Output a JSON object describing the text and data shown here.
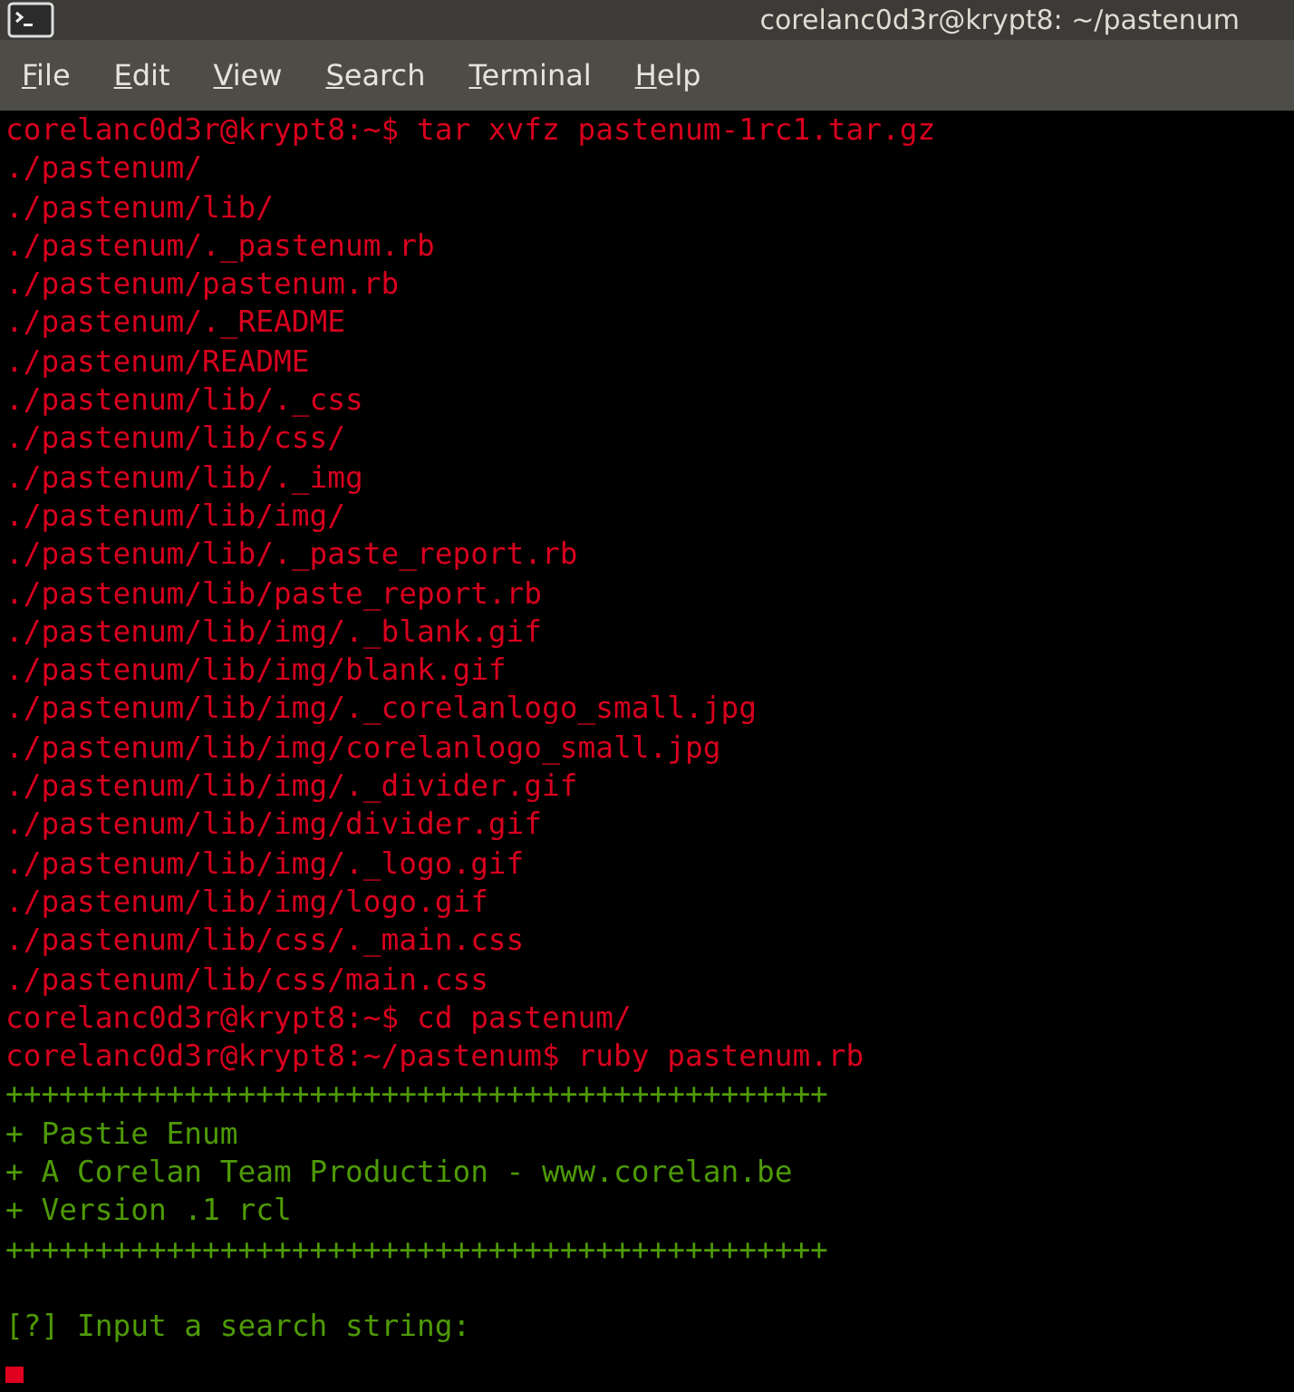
{
  "window": {
    "title": "corelanc0d3r@krypt8: ~/pastenum"
  },
  "menu": [
    "File",
    "Edit",
    "View",
    "Search",
    "Terminal",
    "Help"
  ],
  "terminal": {
    "lines": [
      {
        "kind": "error",
        "text": "corelanc0d3r@krypt8:~$ tar xvfz pastenum-1rc1.tar.gz"
      },
      {
        "kind": "error",
        "text": "./pastenum/"
      },
      {
        "kind": "error",
        "text": "./pastenum/lib/"
      },
      {
        "kind": "error",
        "text": "./pastenum/._pastenum.rb"
      },
      {
        "kind": "error",
        "text": "./pastenum/pastenum.rb"
      },
      {
        "kind": "error",
        "text": "./pastenum/._README"
      },
      {
        "kind": "error",
        "text": "./pastenum/README"
      },
      {
        "kind": "error",
        "text": "./pastenum/lib/._css"
      },
      {
        "kind": "error",
        "text": "./pastenum/lib/css/"
      },
      {
        "kind": "error",
        "text": "./pastenum/lib/._img"
      },
      {
        "kind": "error",
        "text": "./pastenum/lib/img/"
      },
      {
        "kind": "error",
        "text": "./pastenum/lib/._paste_report.rb"
      },
      {
        "kind": "error",
        "text": "./pastenum/lib/paste_report.rb"
      },
      {
        "kind": "error",
        "text": "./pastenum/lib/img/._blank.gif"
      },
      {
        "kind": "error",
        "text": "./pastenum/lib/img/blank.gif"
      },
      {
        "kind": "error",
        "text": "./pastenum/lib/img/._corelanlogo_small.jpg"
      },
      {
        "kind": "error",
        "text": "./pastenum/lib/img/corelanlogo_small.jpg"
      },
      {
        "kind": "error",
        "text": "./pastenum/lib/img/._divider.gif"
      },
      {
        "kind": "error",
        "text": "./pastenum/lib/img/divider.gif"
      },
      {
        "kind": "error",
        "text": "./pastenum/lib/img/._logo.gif"
      },
      {
        "kind": "error",
        "text": "./pastenum/lib/img/logo.gif"
      },
      {
        "kind": "error",
        "text": "./pastenum/lib/css/._main.css"
      },
      {
        "kind": "error",
        "text": "./pastenum/lib/css/main.css"
      },
      {
        "kind": "error",
        "text": "corelanc0d3r@krypt8:~$ cd pastenum/"
      },
      {
        "kind": "error",
        "text": "corelanc0d3r@krypt8:~/pastenum$ ruby pastenum.rb"
      },
      {
        "kind": "output",
        "text": "++++++++++++++++++++++++++++++++++++++++++++++"
      },
      {
        "kind": "output",
        "text": "+ Pastie Enum"
      },
      {
        "kind": "output",
        "text": "+ A Corelan Team Production - www.corelan.be"
      },
      {
        "kind": "output",
        "text": "+ Version .1 rcl"
      },
      {
        "kind": "output",
        "text": "++++++++++++++++++++++++++++++++++++++++++++++"
      },
      {
        "kind": "blank"
      },
      {
        "kind": "output",
        "text": "[?] Input a search string:"
      }
    ],
    "cursor": true
  }
}
